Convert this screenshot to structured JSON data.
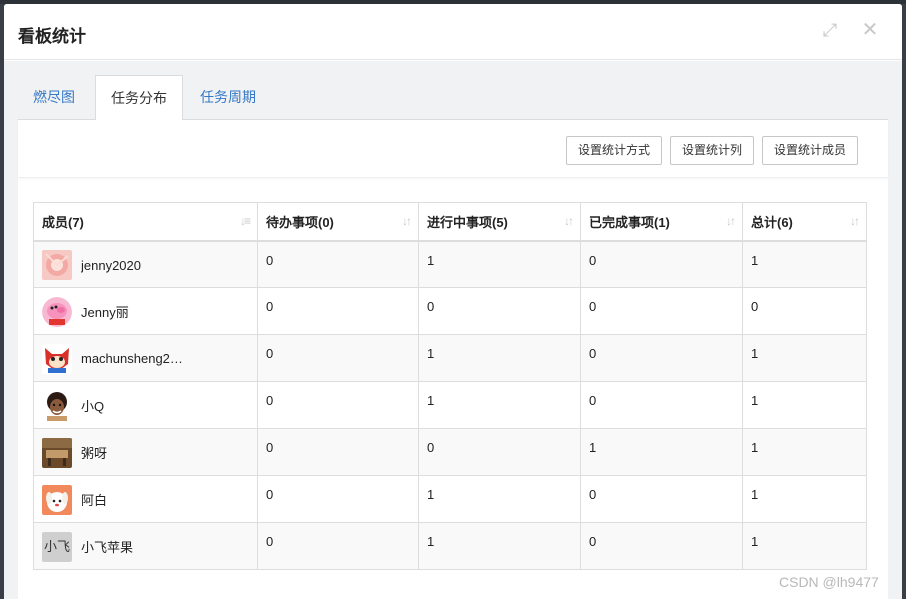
{
  "modal": {
    "title": "看板统计",
    "close_glyph": "✕",
    "expand_glyph": "⤢"
  },
  "tabs": [
    {
      "label": "燃尽图"
    },
    {
      "label": "任务分布"
    },
    {
      "label": "任务周期"
    }
  ],
  "toolbar": {
    "method_label": "设置统计方式",
    "columns_label": "设置统计列",
    "members_label": "设置统计成员"
  },
  "table": {
    "headers": [
      "成员(7)",
      "待办事项(0)",
      "进行中事项(5)",
      "已完成事项(1)",
      "总计(6)"
    ],
    "rows": [
      {
        "name": "jenny2020",
        "avatar": "flower-avatar",
        "todo": "0",
        "doing": "1",
        "done": "0",
        "total": "1"
      },
      {
        "name": "Jenny丽",
        "avatar": "peppa-pig-avatar",
        "todo": "0",
        "doing": "0",
        "done": "0",
        "total": "0"
      },
      {
        "name": "machunsheng2…",
        "avatar": "red-fox-avatar",
        "todo": "0",
        "doing": "1",
        "done": "0",
        "total": "1"
      },
      {
        "name": "小Q",
        "avatar": "curly-hair-avatar",
        "todo": "0",
        "doing": "1",
        "done": "0",
        "total": "1"
      },
      {
        "name": "粥呀",
        "avatar": "wooden-room-avatar",
        "todo": "0",
        "doing": "0",
        "done": "1",
        "total": "1"
      },
      {
        "name": "阿白",
        "avatar": "white-puppy-avatar",
        "todo": "0",
        "doing": "1",
        "done": "0",
        "total": "1"
      },
      {
        "name": "小飞苹果",
        "avatar": "text-avatar",
        "avatar_text": "小飞",
        "todo": "0",
        "doing": "1",
        "done": "0",
        "total": "1"
      }
    ]
  },
  "watermark": "CSDN @lh9477",
  "colors": {
    "accent": "#3478c6",
    "header_bg": "#ffffff",
    "body_bg": "#f1f2f4"
  }
}
